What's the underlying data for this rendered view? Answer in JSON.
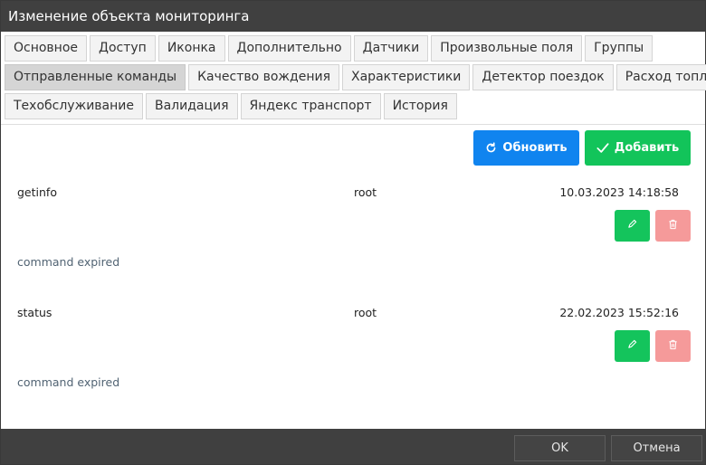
{
  "window": {
    "title": "Изменение объекта мониторинга"
  },
  "tabs": {
    "row1": [
      "Основное",
      "Доступ",
      "Иконка",
      "Дополнительно",
      "Датчики",
      "Произвольные поля",
      "Группы"
    ],
    "row2": [
      "Отправленные команды",
      "Качество вождения",
      "Характеристики",
      "Детектор поездок",
      "Расход топлива"
    ],
    "row3": [
      "Техобслуживание",
      "Валидация",
      "Яндекс транспорт",
      "История"
    ],
    "active": "Отправленные команды"
  },
  "toolbar": {
    "refresh_label": "Обновить",
    "add_label": "Добавить"
  },
  "commands": [
    {
      "name": "getinfo",
      "user": "root",
      "date": "10.03.2023 14:18:58",
      "status": "command expired"
    },
    {
      "name": "status",
      "user": "root",
      "date": "22.02.2023 15:52:16",
      "status": "command expired"
    }
  ],
  "footer": {
    "ok_label": "OK",
    "cancel_label": "Отмена"
  },
  "colors": {
    "titlebar": "#404040",
    "refresh": "#1084ef",
    "add": "#12c45a",
    "edit": "#14c45c",
    "delete": "#f59a9a"
  },
  "icons": {
    "refresh": "refresh-icon",
    "add": "check-icon",
    "edit": "pencil-icon",
    "delete": "trash-icon"
  }
}
